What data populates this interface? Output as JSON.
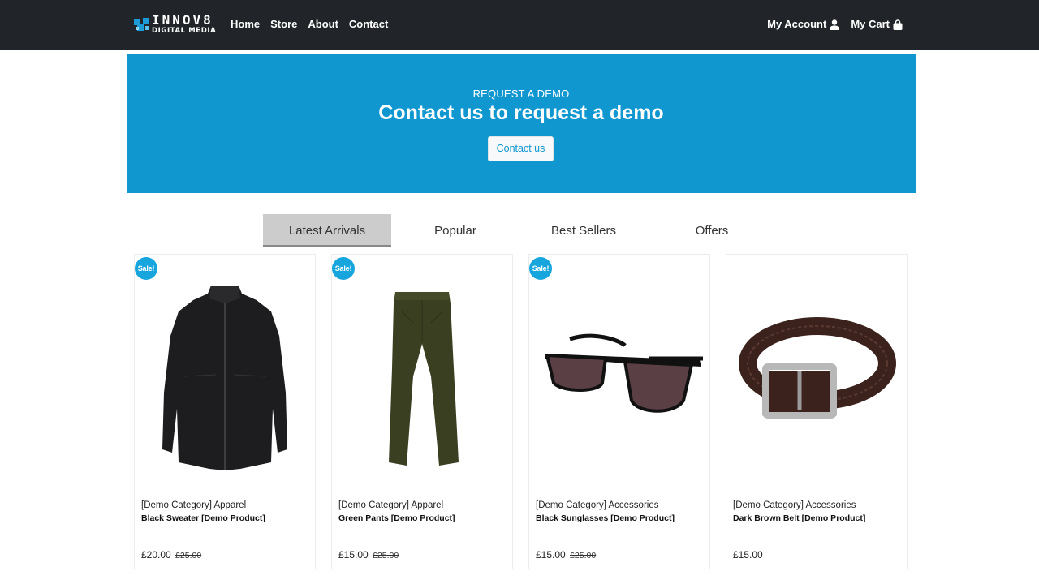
{
  "brand": {
    "line1": "INNOV8",
    "line2": "DIGITAL MEDIA",
    "accent": "#1b9bd7"
  },
  "nav": {
    "links": [
      "Home",
      "Store",
      "About",
      "Contact"
    ],
    "account_label": "My Account",
    "cart_label": "My Cart",
    "bg": "#212529"
  },
  "hero": {
    "kicker": "REQUEST A DEMO",
    "title": "Contact us to request a demo",
    "button": "Contact us",
    "bg": "#1097d0"
  },
  "tabs": [
    "Latest Arrivals",
    "Popular",
    "Best Sellers",
    "Offers"
  ],
  "products": [
    {
      "badge": "Sale!",
      "category": "[Demo Category] Apparel",
      "name": "Black Sweater [Demo Product]",
      "price": "£20.00",
      "old_price": "£25.00",
      "image": "black-sweater-image"
    },
    {
      "badge": "Sale!",
      "category": "[Demo Category] Apparel",
      "name": "Green Pants [Demo Product]",
      "price": "£15.00",
      "old_price": "£25.00",
      "image": "green-pants-image"
    },
    {
      "badge": "Sale!",
      "category": "[Demo Category] Accessories",
      "name": "Black Sunglasses [Demo Product]",
      "price": "£15.00",
      "old_price": "£25.00",
      "image": "black-sunglasses-image"
    },
    {
      "badge": "",
      "category": "[Demo Category] Accessories",
      "name": "Dark Brown Belt [Demo Product]",
      "price": "£15.00",
      "old_price": "",
      "image": "brown-belt-image"
    }
  ],
  "colors": {
    "sale_badge": "#16a6dd",
    "active_tab": "#cccccc"
  }
}
